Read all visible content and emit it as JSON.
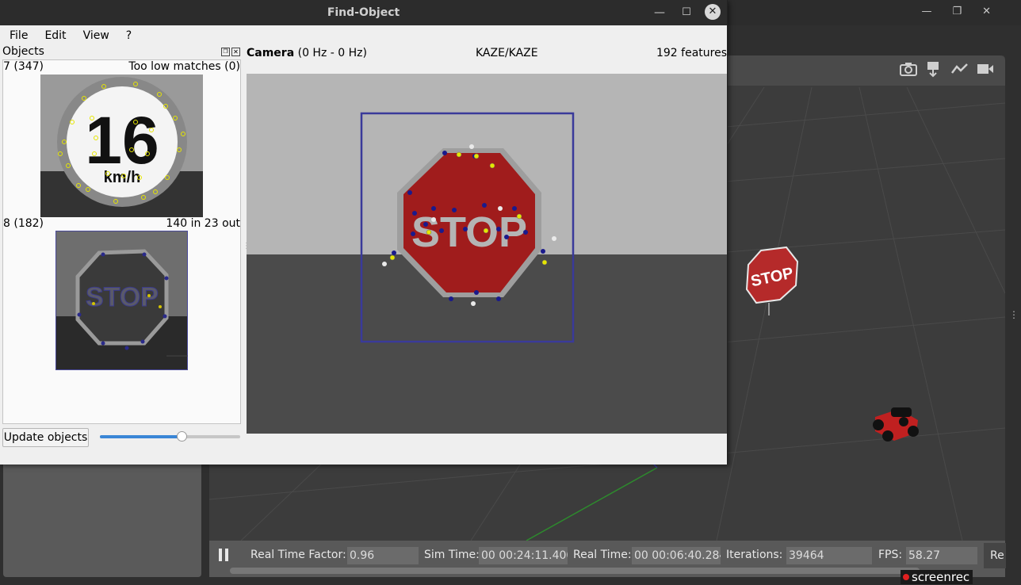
{
  "window": {
    "title": "Find-Object",
    "min_glyph": "—",
    "max_glyph": "☐",
    "close_glyph": "✕"
  },
  "menu": [
    "File",
    "Edit",
    "View",
    "?"
  ],
  "objects_panel": {
    "title": "Objects",
    "float_glyph": "❐",
    "close_glyph": "✕",
    "objects": [
      {
        "id_label": "7 (347)",
        "status": "Too low matches (0)",
        "image": "speed-limit-16-sign"
      },
      {
        "id_label": "8 (182)",
        "status": "140 in 23 out",
        "image": "stop-sign"
      }
    ],
    "update_button": "Update objects",
    "slider_value": 0.58
  },
  "camera": {
    "title": "Camera",
    "rate": "(0 Hz - 0 Hz)",
    "descriptor": "KAZE/KAZE",
    "features": "192 features",
    "sign_text": "STOP"
  },
  "background_app": {
    "scene_sign_text": "STOP",
    "status": {
      "real_time_factor_label": "Real Time Factor:",
      "real_time_factor": "0.96",
      "sim_time_label": "Sim Time:",
      "sim_time": "00 00:24:11.400",
      "real_time_label": "Real Time:",
      "real_time": "00 00:06:40.284",
      "iterations_label": "Iterations:",
      "iterations": "39464",
      "fps_label": "FPS:",
      "fps": "58.27",
      "reset_label": "Re"
    },
    "toolbar_icons": [
      "camera-icon",
      "log-icon",
      "plot-icon",
      "video-icon"
    ],
    "window_controls": [
      "—",
      "❐",
      "✕"
    ]
  },
  "watermark": "screenrec",
  "colors": {
    "stop_red": "#a01c1c",
    "bbox_blue": "#3a3a9a",
    "keypoint_yellow": "#e6e600",
    "keypoint_navy": "#1a1a8c",
    "slider_blue": "#3a86d6"
  }
}
